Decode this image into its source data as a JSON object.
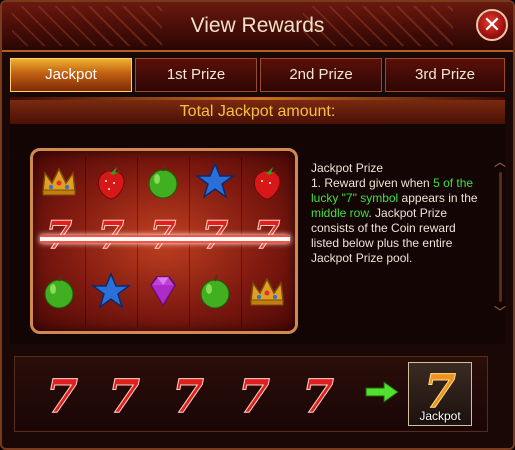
{
  "window": {
    "title": "View Rewards"
  },
  "tabs": [
    {
      "label": "Jackpot",
      "active": true
    },
    {
      "label": "1st Prize",
      "active": false
    },
    {
      "label": "2nd Prize",
      "active": false
    },
    {
      "label": "3rd Prize",
      "active": false
    }
  ],
  "heading": "Total Jackpot amount:",
  "reel": {
    "rows": [
      [
        "crown",
        "strawberry",
        "apple",
        "star",
        "strawberry"
      ],
      [
        "seven",
        "seven",
        "seven",
        "seven",
        "seven"
      ],
      [
        "apple",
        "star",
        "diamond",
        "apple",
        "crown"
      ]
    ],
    "highlighted_row": "middle"
  },
  "description": {
    "title": "Jackpot Prize",
    "line1_a": "1. Reward given when ",
    "line1_hl": "5 of the lucky \"7\" symbol",
    "line1_b": " appears in the ",
    "line1_hl2": "middle row",
    "line1_c": ". Jackpot Prize consists of the Coin reward listed below plus the entire Jackpot Prize pool."
  },
  "combo": {
    "symbols": [
      "seven",
      "seven",
      "seven",
      "seven",
      "seven"
    ],
    "arrow_icon": "arrow-right-icon",
    "result_label": "Jackpot"
  },
  "colors": {
    "accent_gold": "#f8c040",
    "highlight_green": "#40e040",
    "close_red": "#c01818"
  }
}
